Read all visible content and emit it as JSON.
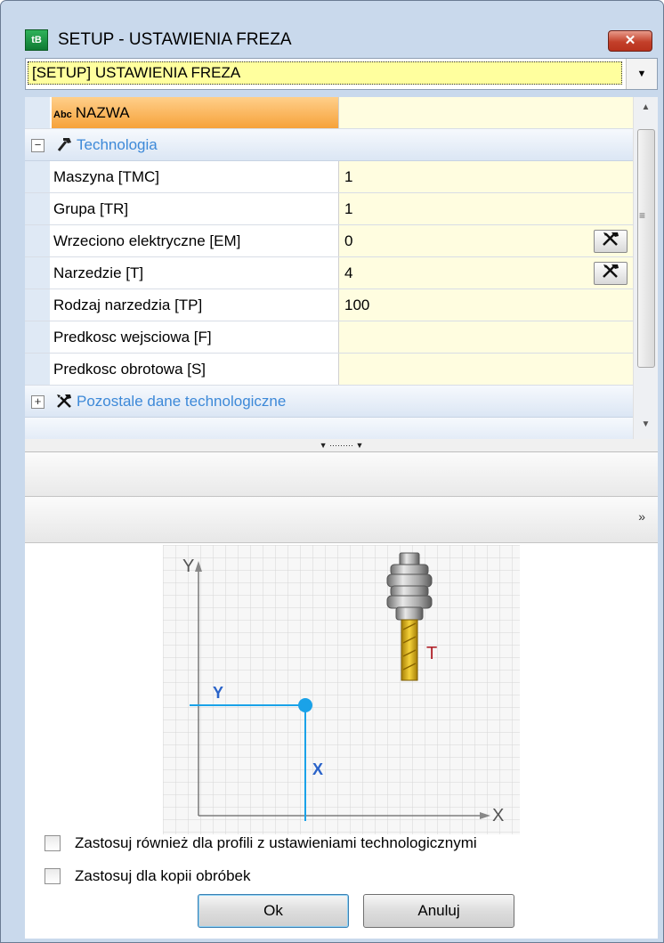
{
  "window": {
    "title": "SETUP - USTAWIENIA FREZA",
    "close_label": "✕"
  },
  "selector": {
    "value": "[SETUP] USTAWIENIA FREZA"
  },
  "properties": {
    "name": {
      "label": "NAZWA",
      "value": ""
    },
    "group_technology": {
      "title": "Technologia",
      "expander": "−"
    },
    "rows": [
      {
        "label": "Maszyna [TMC]",
        "value": "1"
      },
      {
        "label": "Grupa [TR]",
        "value": "1"
      },
      {
        "label": "Wrzeciono elektryczne [EM]",
        "value": "0"
      },
      {
        "label": "Narzedzie [T]",
        "value": "4"
      },
      {
        "label": "Rodzaj narzedzia [TP]",
        "value": "100"
      },
      {
        "label": "Predkosc wejsciowa [F]",
        "value": ""
      },
      {
        "label": "Predkosc obrotowa [S]",
        "value": ""
      }
    ],
    "group_other": {
      "title": "Pozostale dane technologiczne",
      "expander": "+"
    }
  },
  "preview": {
    "axis_y": "Y",
    "axis_x": "X",
    "label_y": "Y",
    "label_x": "X",
    "tool_label": "T"
  },
  "options": {
    "apply_profiles": "Zastosuj również dla profili z ustawieniami technologicznymi",
    "apply_copies": "Zastosuj dla kopii obróbek"
  },
  "buttons": {
    "ok": "Ok",
    "cancel": "Anuluj"
  },
  "colors": {
    "accent_orange": "#f6a23a",
    "field_bg": "#fffde0",
    "group_text": "#3d89d8",
    "axis_blue": "#1aa2e8",
    "tool_gold": "#e0b020"
  }
}
